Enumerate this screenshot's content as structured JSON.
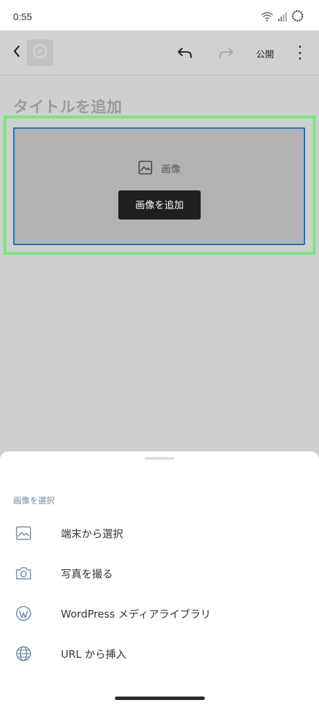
{
  "status_bar": {
    "time": "0:55",
    "icons": [
      "wifi-icon",
      "signal-icon",
      "sync-icon"
    ]
  },
  "toolbar": {
    "back_icon": "chevron-left-icon",
    "site_icon": "compass-icon",
    "undo_icon": "undo-icon",
    "redo_icon": "redo-icon",
    "publish_label": "公開",
    "more_icon": "more-vertical-icon"
  },
  "editor": {
    "title_placeholder": "タイトルを追加",
    "image_block": {
      "icon": "image-icon",
      "label": "画像",
      "add_button_label": "画像を追加"
    }
  },
  "bottom_sheet": {
    "heading": "画像を選択",
    "items": [
      {
        "icon": "image-icon",
        "label": "端末から選択"
      },
      {
        "icon": "camera-icon",
        "label": "写真を撮る"
      },
      {
        "icon": "wordpress-icon",
        "label": "WordPress メディアライブラリ"
      },
      {
        "icon": "globe-icon",
        "label": "URL から挿入"
      }
    ]
  },
  "colors": {
    "accent": "#1e6fb8",
    "highlight": "#74ea7e",
    "overlay": "#cfcfcf",
    "menu_icon": "#6f8ea8"
  }
}
